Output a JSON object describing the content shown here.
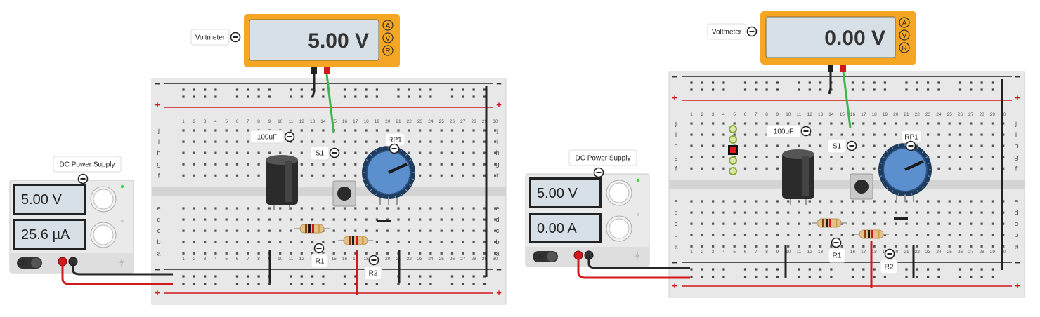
{
  "circuits": [
    {
      "voltmeter_label": "Voltmeter",
      "voltmeter_reading": "5.00 V",
      "meter_buttons": [
        "A",
        "V",
        "R"
      ],
      "power_supply_label": "DC Power Supply",
      "ps_voltage": "5.00 V",
      "ps_current": "25.6 µA",
      "ps_switch": "ON",
      "capacitor_label": "100uF",
      "switch_label": "S1",
      "pot_label": "RP1",
      "r1_label": "R1",
      "r2_label": "R2"
    },
    {
      "voltmeter_label": "Voltmeter",
      "voltmeter_reading": "0.00 V",
      "meter_buttons": [
        "A",
        "V",
        "R"
      ],
      "power_supply_label": "DC Power Supply",
      "ps_voltage": "5.00 V",
      "ps_current": "0.00 A",
      "ps_switch": "ON",
      "capacitor_label": "100uF",
      "switch_label": "S1",
      "pot_label": "RP1",
      "r1_label": "R1",
      "r2_label": "R2"
    }
  ],
  "breadboard": {
    "row_letters_top": [
      "j",
      "i",
      "h",
      "g",
      "f"
    ],
    "row_letters_bottom": [
      "e",
      "d",
      "c",
      "b",
      "a"
    ],
    "rail_plus": "+",
    "rail_minus": "−"
  },
  "colors": {
    "meter_frame": "#f5a623",
    "lcd": "#d7e0e6",
    "wire_red": "#d0191d",
    "wire_black": "#262626",
    "wire_green": "#3db54a",
    "pot_knob": "#5b8fcd"
  }
}
